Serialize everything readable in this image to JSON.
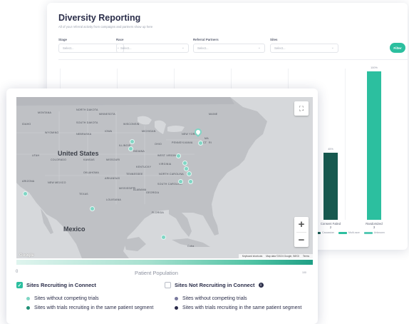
{
  "report": {
    "title": "Diversity Reporting",
    "subtitle": "All of your referral activity from campaigns and partners show up here",
    "filters": [
      {
        "label": "Stage",
        "placeholder": "Select..."
      },
      {
        "label": "Race",
        "placeholder": "Select..."
      },
      {
        "label": "Referral Partners",
        "placeholder": "Select..."
      },
      {
        "label": "Sites",
        "placeholder": "Select..."
      }
    ],
    "filter_button": "Filter"
  },
  "chart_data": {
    "type": "bar",
    "categories": [
      "Consent Failed\n2",
      "Randomized\n3"
    ],
    "series": [
      {
        "name": "Caucasian",
        "color": "#17594f",
        "values": [
          45,
          null
        ]
      },
      {
        "name": "Multi-race",
        "color": "#2cbf9f",
        "values": [
          null,
          100
        ]
      },
      {
        "name": "Unknown",
        "color": "#56c9b4",
        "values": [
          null,
          null
        ]
      }
    ],
    "data_labels": [
      "45%",
      "100%"
    ],
    "ylim": [
      0,
      100
    ]
  },
  "map": {
    "big_labels": [
      "United States",
      "Mexico"
    ],
    "state_labels": [
      "MONTANA",
      "NORTH DAKOTA",
      "SOUTH DAKOTA",
      "WYOMING",
      "NEBRASKA",
      "IOWA",
      "ILLINOIS",
      "INDIANA",
      "OHIO",
      "MICHIGAN",
      "WISCONSIN",
      "MINNESOTA",
      "IDAHO",
      "UTAH",
      "COLORADO",
      "KANSAS",
      "MISSOURI",
      "KENTUCKY",
      "WEST VIRGINIA",
      "VIRGINIA",
      "NORTH CAROLINA",
      "SOUTH CAROLINA",
      "TENNESSEE",
      "ARKANSAS",
      "OKLAHOMA",
      "TEXAS",
      "NEW MEXICO",
      "ARIZONA",
      "LOUISIANA",
      "MISSISSIPPI",
      "ALABAMA",
      "GEORGIA",
      "FLORIDA",
      "NEW YORK",
      "PENNSYLVANIA",
      "MAINE",
      "MA",
      "CT",
      "RI",
      "Cuba"
    ],
    "footer": [
      "Keyboard shortcuts",
      "Map data ©2024 Google, INEGI",
      "Terms"
    ],
    "google": "Google",
    "zoom_in": "+",
    "zoom_out": "−",
    "fullscreen_icon": "⛶"
  },
  "scale": {
    "min": "0",
    "max": "100",
    "title": "Patient Population"
  },
  "recruiting": {
    "title": "Sites Recruiting in Connect",
    "checked": true,
    "items": [
      {
        "label": "Sites without competing trials",
        "color": "#7fd6c4"
      },
      {
        "label": "Sites with trials recruiting in the same patient segment",
        "color": "#1f8f75"
      }
    ]
  },
  "not_recruiting": {
    "title": "Sites Not Recruiting in Connect",
    "checked": false,
    "items": [
      {
        "label": "Sites without competing trials",
        "color": "#7a7a9e"
      },
      {
        "label": "Sites with trials recruiting in the same patient segment",
        "color": "#2b2b4a"
      }
    ]
  }
}
